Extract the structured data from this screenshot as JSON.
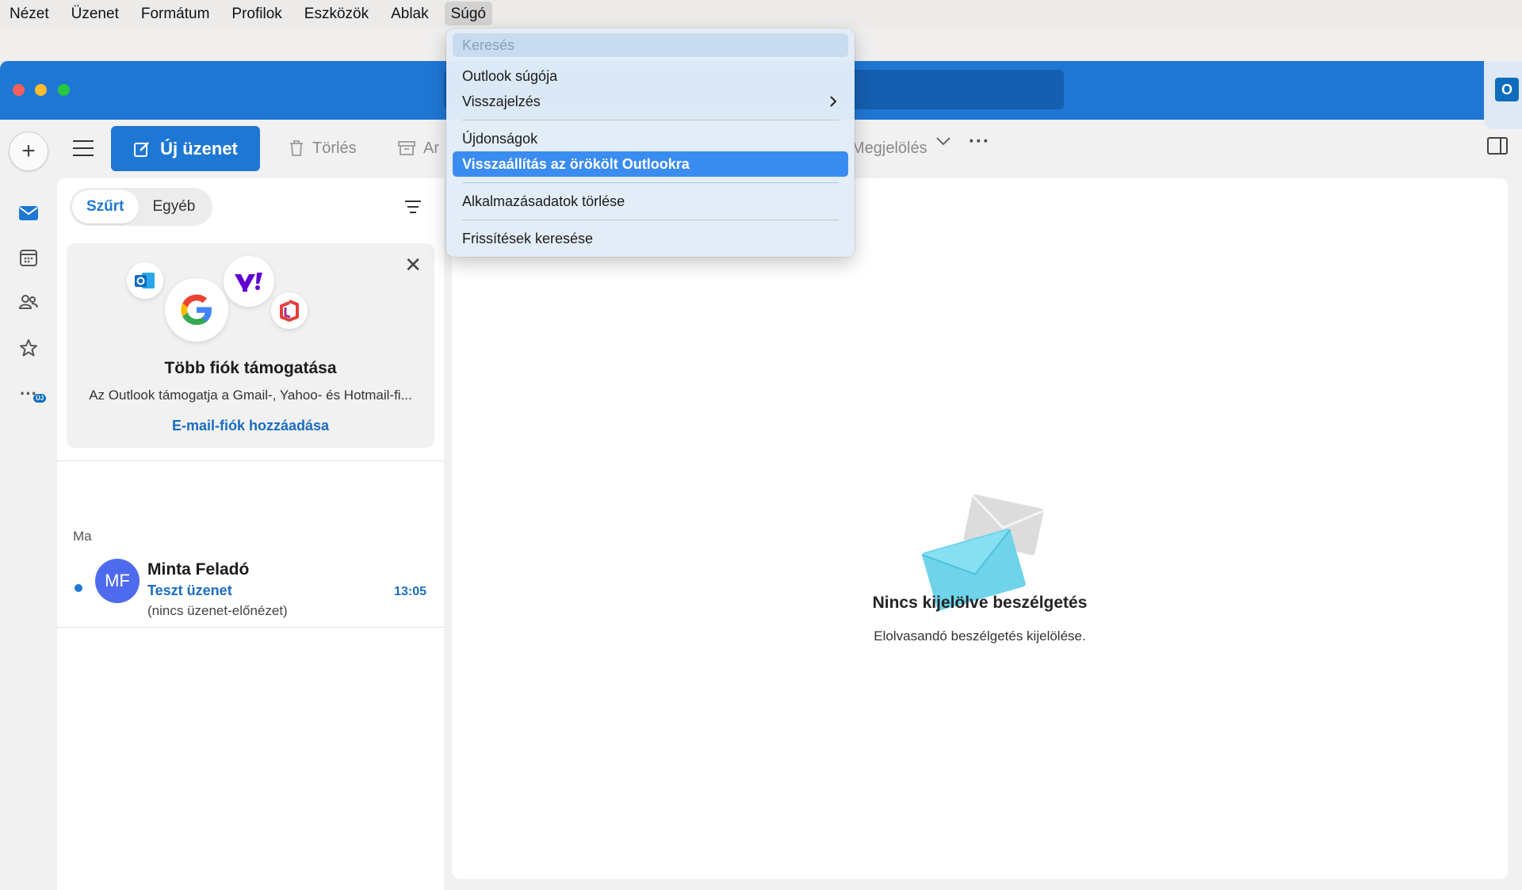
{
  "menubar": {
    "items": [
      "Nézet",
      "Üzenet",
      "Formátum",
      "Profilok",
      "Eszközök",
      "Ablak",
      "Súgó"
    ],
    "active": "Súgó"
  },
  "help_menu": {
    "search_placeholder": "Keresés",
    "items": {
      "help": "Outlook súgója",
      "feedback": "Visszajelzés",
      "whats_new": "Újdonságok",
      "revert": "Visszaállítás az örökölt Outlookra",
      "reset_data": "Alkalmazásadatok törlése",
      "check_updates": "Frissítések keresése"
    },
    "highlighted": "revert"
  },
  "toolbar": {
    "new_message": "Új üzenet",
    "delete": "Törlés",
    "archive_partial": "Ar",
    "flag_partial": "Megjelölés"
  },
  "rail": {
    "new_badge": "ÚJ"
  },
  "list": {
    "tabs": [
      "Szűrt",
      "Egyéb"
    ],
    "active_tab": "Szűrt",
    "promo": {
      "title": "Több fiók támogatása",
      "description": "Az Outlook támogatja a Gmail-, Yahoo- és Hotmail-fi...",
      "link": "E-mail-fiók hozzáadása"
    },
    "group_label": "Ma",
    "messages": [
      {
        "initials": "MF",
        "sender": "Minta Feladó",
        "subject": "Teszt üzenet",
        "preview": "(nincs üzenet-előnézet)",
        "time": "13:05",
        "unread": true
      }
    ]
  },
  "reading_pane": {
    "title": "Nincs kijelölve beszélgetés",
    "subtitle": "Elolvasandó beszélgetés kijelölése."
  },
  "colors": {
    "accent": "#1f77d4",
    "link": "#1b6dc1",
    "avatar": "#4f6bed",
    "highlight": "#3b8cf0"
  }
}
